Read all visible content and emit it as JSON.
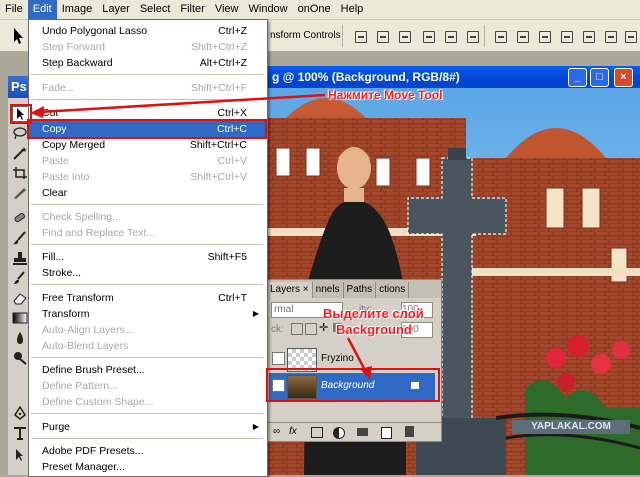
{
  "menubar": {
    "items": [
      "File",
      "Edit",
      "Image",
      "Layer",
      "Select",
      "Filter",
      "View",
      "Window",
      "onOne",
      "Help"
    ],
    "active": "Edit"
  },
  "options_bar": {
    "transform_controls_label": "nsform Controls"
  },
  "document": {
    "title": "g @ 100% (Background, RGB/8#)",
    "min": "_",
    "max": "□",
    "close": "×"
  },
  "toolbox": {
    "logo": "Ps"
  },
  "edit_menu": {
    "items": [
      {
        "label": "Undo Polygonal Lasso",
        "shortcut": "Ctrl+Z",
        "disabled": false
      },
      {
        "label": "Step Forward",
        "shortcut": "Shift+Ctrl+Z",
        "disabled": true
      },
      {
        "label": "Step Backward",
        "shortcut": "Alt+Ctrl+Z",
        "disabled": false
      },
      {
        "label": "Fade...",
        "shortcut": "Shift+Ctrl+F",
        "disabled": true
      },
      {
        "label": "Cut",
        "shortcut": "Ctrl+X",
        "disabled": false
      },
      {
        "label": "Copy",
        "shortcut": "Ctrl+C",
        "disabled": false,
        "highlighted": true
      },
      {
        "label": "Copy Merged",
        "shortcut": "Shift+Ctrl+C",
        "disabled": false
      },
      {
        "label": "Paste",
        "shortcut": "Ctrl+V",
        "disabled": true
      },
      {
        "label": "Paste Into",
        "shortcut": "Shift+Ctrl+V",
        "disabled": true
      },
      {
        "label": "Clear",
        "shortcut": "",
        "disabled": false
      },
      {
        "label": "Check Spelling...",
        "shortcut": "",
        "disabled": true
      },
      {
        "label": "Find and Replace Text...",
        "shortcut": "",
        "disabled": true
      },
      {
        "label": "Fill...",
        "shortcut": "Shift+F5",
        "disabled": false
      },
      {
        "label": "Stroke...",
        "shortcut": "",
        "disabled": false
      },
      {
        "label": "Free Transform",
        "shortcut": "Ctrl+T",
        "disabled": false
      },
      {
        "label": "Transform",
        "shortcut": "",
        "disabled": false,
        "submenu": true
      },
      {
        "label": "Auto-Align Layers...",
        "shortcut": "",
        "disabled": true
      },
      {
        "label": "Auto-Blend Layers",
        "shortcut": "",
        "disabled": true
      },
      {
        "label": "Define Brush Preset...",
        "shortcut": "",
        "disabled": false
      },
      {
        "label": "Define Pattern...",
        "shortcut": "",
        "disabled": true
      },
      {
        "label": "Define Custom Shape...",
        "shortcut": "",
        "disabled": true
      },
      {
        "label": "Purge",
        "shortcut": "",
        "disabled": false,
        "submenu": true
      },
      {
        "label": "Adobe PDF Presets...",
        "shortcut": "",
        "disabled": false
      },
      {
        "label": "Preset Manager...",
        "shortcut": "",
        "disabled": false
      }
    ]
  },
  "layers_panel": {
    "tabs": [
      "Layers ×",
      "nnels",
      "Paths",
      "ctions"
    ],
    "blend_mode": "rmal",
    "opacity_label": "ity:",
    "opacity_value": "100",
    "lock_label": "ck:",
    "fill_value": "100",
    "layers": [
      {
        "name": "Fryzino",
        "selected": false
      },
      {
        "name": "Background",
        "selected": true
      }
    ]
  },
  "annotations": {
    "move_tool": "Нажмите Move Tool",
    "select_layer_line1": "Выделите слой",
    "select_layer_line2": "Background"
  },
  "watermark": "YAPLAKAL.COM",
  "colors": {
    "accent": "#316ac5",
    "annotation": "#ff1a1a",
    "titlebar": "#0a5ef0"
  }
}
